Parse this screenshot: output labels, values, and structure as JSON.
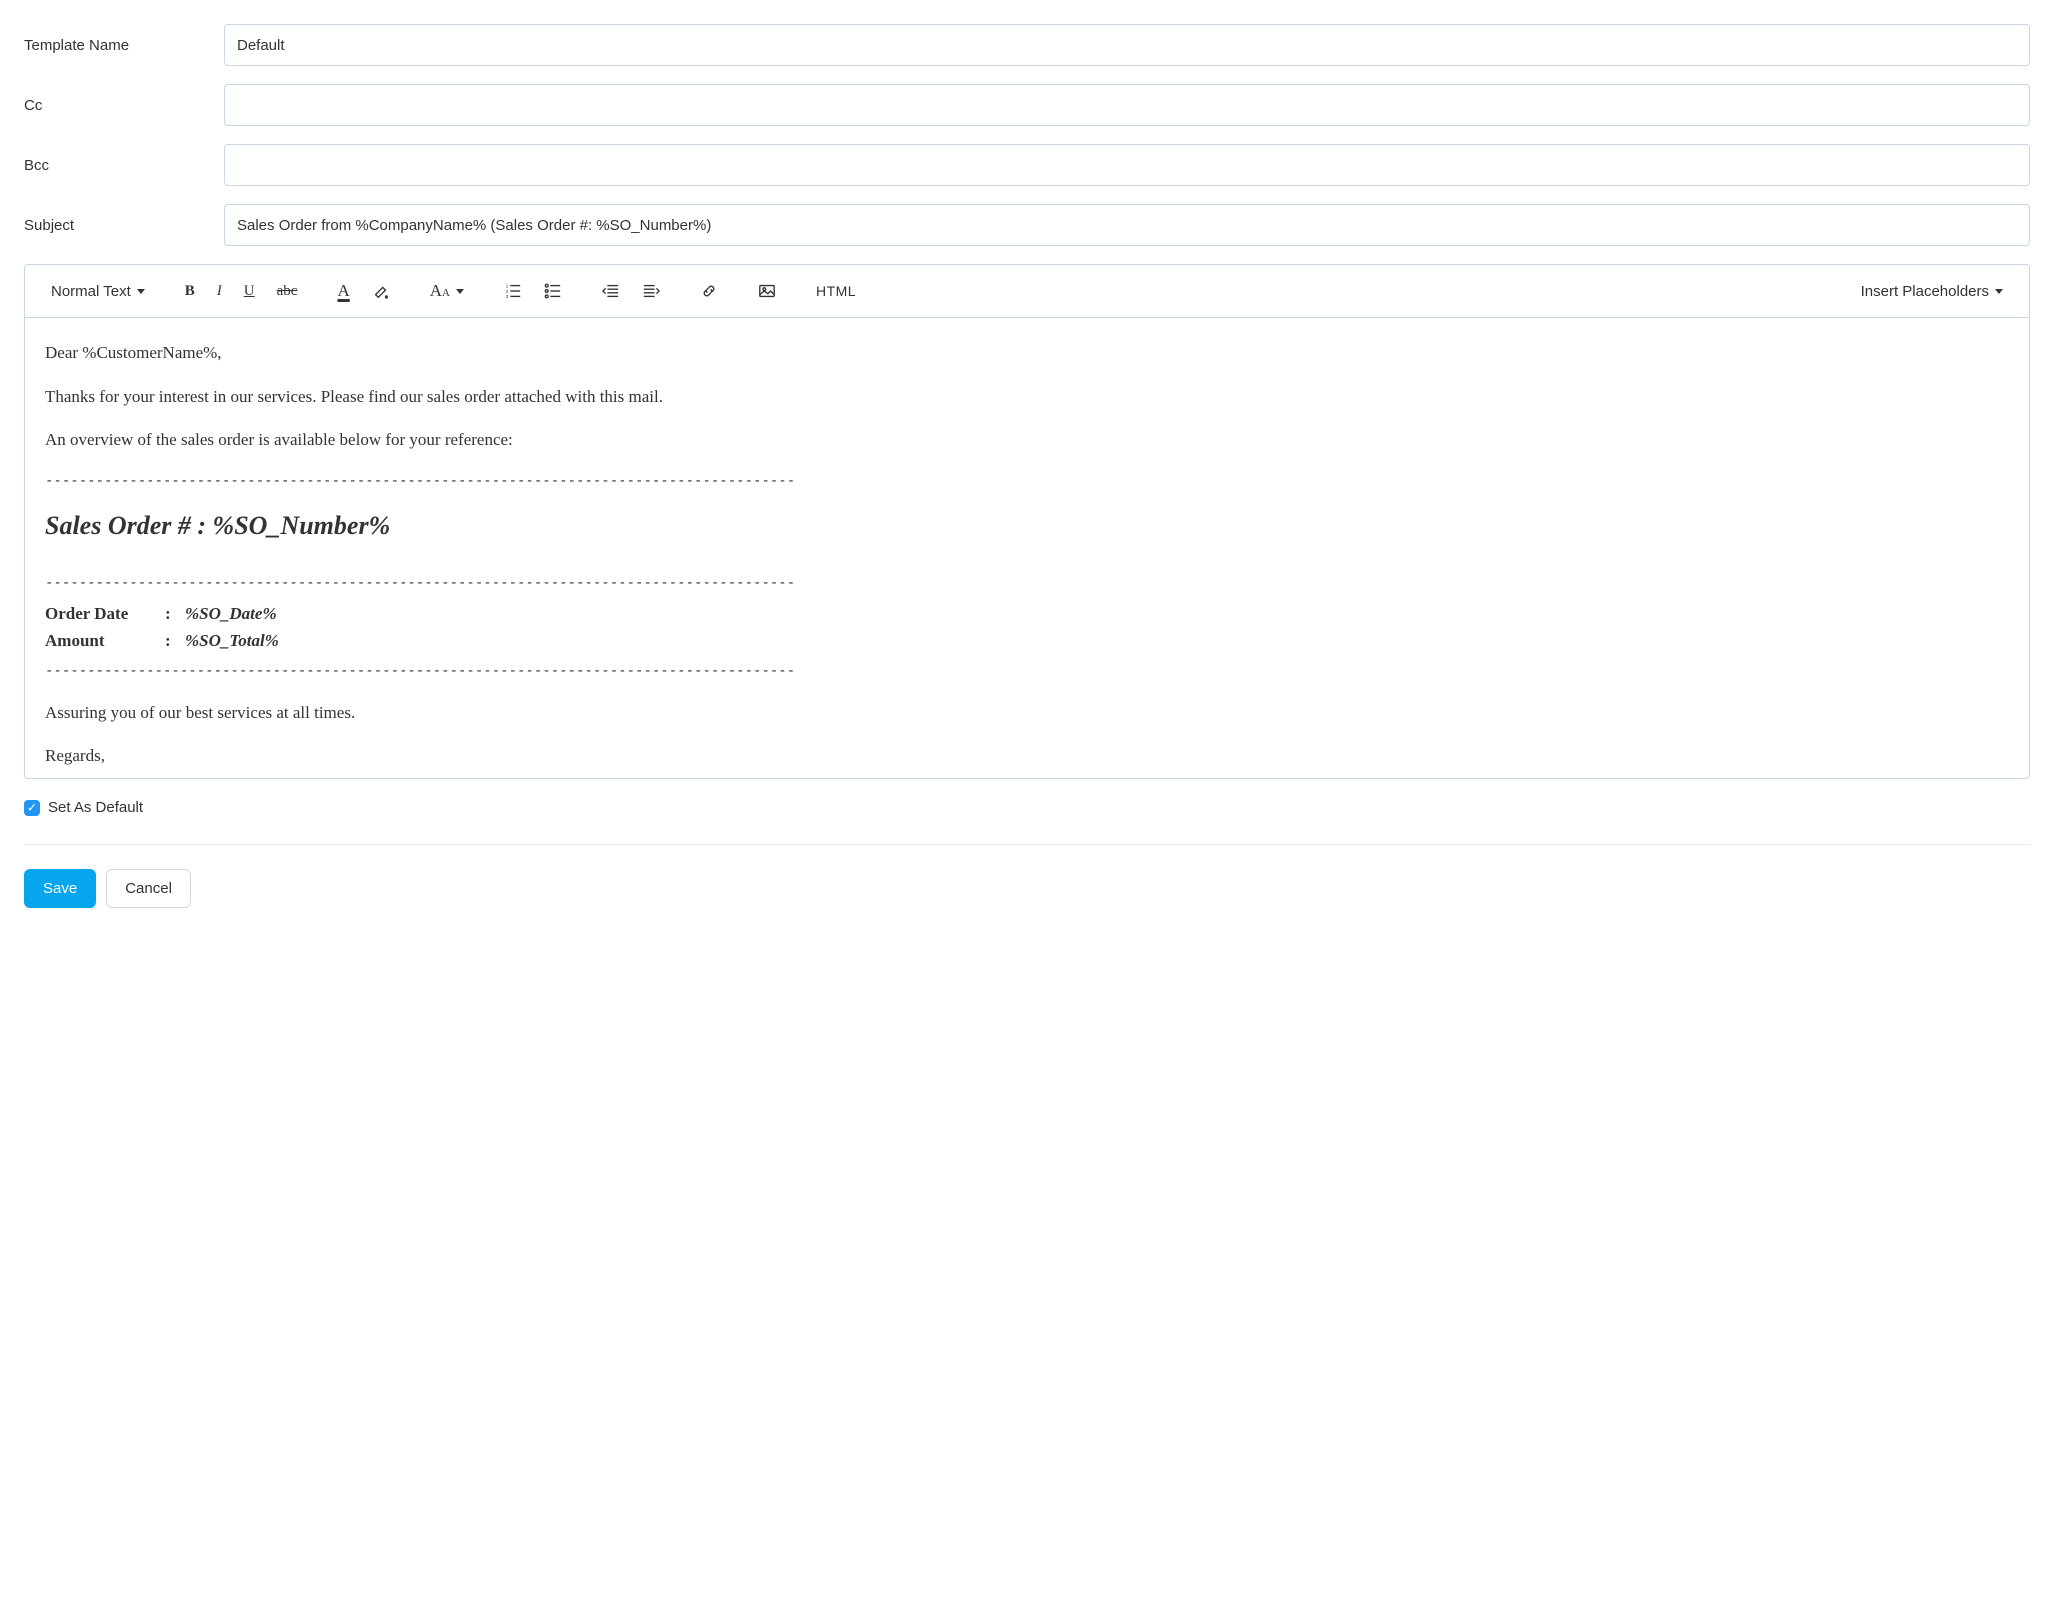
{
  "form": {
    "templateName": {
      "label": "Template Name",
      "value": "Default"
    },
    "cc": {
      "label": "Cc",
      "value": ""
    },
    "bcc": {
      "label": "Bcc",
      "value": ""
    },
    "subject": {
      "label": "Subject",
      "value": "Sales Order from %CompanyName% (Sales Order #: %SO_Number%)"
    }
  },
  "toolbar": {
    "blockFormat": "Normal Text",
    "html": "HTML",
    "insertPlaceholders": "Insert Placeholders"
  },
  "body": {
    "greeting": "Dear %CustomerName%,",
    "line1": "Thanks for your interest in our services. Please find our sales order attached with this mail.",
    "line2": "An overview of the sales order is available below for your reference:",
    "dashes": "-----------------------------------------------------------------------------------------",
    "heading": "Sales Order # : %SO_Number%",
    "rows": [
      {
        "k": "Order Date",
        "c": ":",
        "v": "%SO_Date%"
      },
      {
        "k": "Amount",
        "c": ":",
        "v": "%SO_Total%"
      }
    ],
    "closing1": "Assuring you of our best services at all times.",
    "closing2": "Regards,"
  },
  "setDefault": {
    "label": "Set As Default",
    "checked": true
  },
  "actions": {
    "save": "Save",
    "cancel": "Cancel"
  }
}
